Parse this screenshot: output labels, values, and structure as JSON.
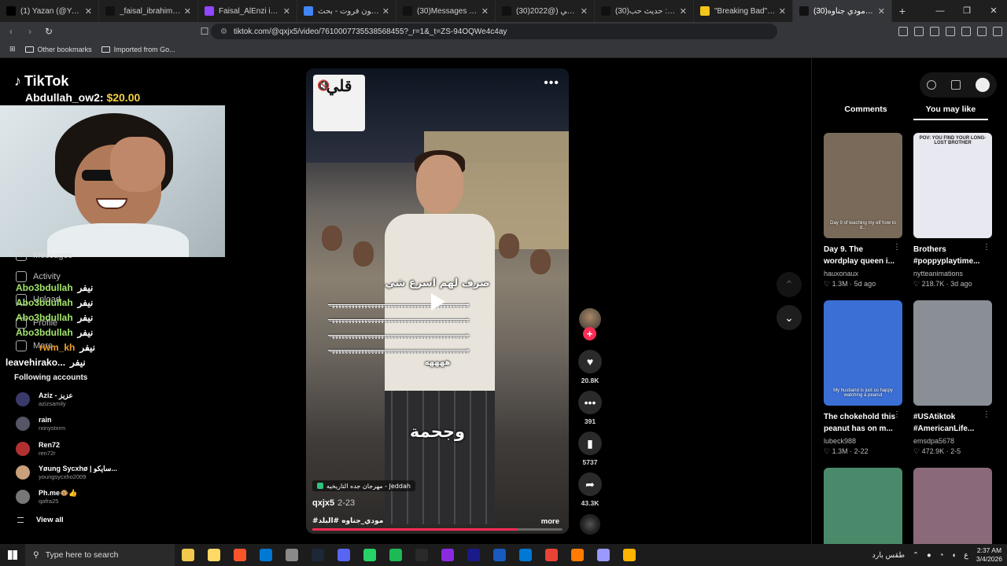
{
  "browser": {
    "tabs": [
      {
        "label": "(1) Yazan (@YazanWasHiro",
        "color": "#000000"
      },
      {
        "label": "_faisal_ibrahim_f) | TikTok",
        "color": "#111111"
      },
      {
        "label": "Faisal_AlEnzi in JACO - JAC",
        "color": "#9146ff"
      },
      {
        "label": "دراغون فروت - بحث Google",
        "color": "#4285f4"
      },
      {
        "label": "(30)Messages | TikTok",
        "color": "#111111"
      },
      {
        "label": "(30)حسين البارقي (@2022",
        "color": "#111111"
      },
      {
        "label": "(30)حسين البارقي: حديث حب",
        "color": "#111111"
      },
      {
        "label": "\"Breaking Bad\" Ozymandi",
        "color": "#f5c518"
      },
      {
        "label": "(30)أغاني مودي جناوه",
        "color": "#111111",
        "active": true
      }
    ],
    "new_tab": "+",
    "url": "tiktok.com/@qxjx5/video/7610007735538568455?_r=1&_t=ZS-94OQWe4c4ay",
    "bookmarks": [
      "Other bookmarks",
      "Imported from Go..."
    ]
  },
  "left": {
    "logo_text": "TikTok",
    "donation_user": "Abdullah_ow2:",
    "donation_amount": "$20.00",
    "chat": [
      {
        "nick": "Abo3bdullah",
        "msg": "نيفر",
        "cls": ""
      },
      {
        "nick": "Abo3bdullah",
        "msg": "نيفر",
        "cls": ""
      },
      {
        "nick": "Abo3bdullah",
        "msg": "نيفر",
        "cls": ""
      },
      {
        "nick": "Abo3bdullah",
        "msg": "نيفر",
        "cls": ""
      },
      {
        "nick": "rwm_kh",
        "msg": "نيفر",
        "cls": "orange"
      },
      {
        "nick": "leavehirako...",
        "msg": "نيفر",
        "cls": "white"
      }
    ],
    "ghost_nav": [
      "Messages",
      "Activity",
      "Upload",
      "Profile",
      "More"
    ],
    "following_title": "Following accounts",
    "accounts": [
      {
        "name": "Aziz - عزيز",
        "handle": "azizsamily",
        "color": "#3a3a6a"
      },
      {
        "name": "rain",
        "handle": "rxinystxrm",
        "color": "#555566"
      },
      {
        "name": "Ren72",
        "handle": "ren72r",
        "color": "#b33030"
      },
      {
        "name": "Yøung Sycxhø | سايكو...",
        "handle": "youngsycxho2009",
        "color": "#c9a07a"
      },
      {
        "name": "Ph.me🐵👍",
        "handle": "qafra25",
        "color": "#777777"
      }
    ],
    "view_all": "View all"
  },
  "video": {
    "logo_text": "قلي",
    "mute_icon": "🔇",
    "more_icon": "•••",
    "caption_top": "صرف لهم اسرع شي",
    "strike_char": "ههههههههههههههههههههههههههههههههههههههههههه",
    "laugh_tail": "ههههه",
    "caption_bottom": "وجحمة",
    "location": "مهرجان جده التاريخيه - Jeddah",
    "author": "qxjx5",
    "date": "2-23",
    "hashtags": "#مودي_جناوه #البلد",
    "more_label": "more",
    "progress_percent": 82
  },
  "actions": {
    "follow": "+",
    "likes": "20.8K",
    "comments": "391",
    "saves": "5737",
    "shares": "43.3K"
  },
  "right": {
    "tabs": [
      "Comments",
      "You may like"
    ],
    "cards": [
      {
        "title": "Day 9. The wordplay queen i...",
        "author": "hauxonaux",
        "views": "1.3M",
        "age": "5d ago",
        "bg": "#7a6a5a",
        "overlay": "Day 9 of teaching my elf how to d..."
      },
      {
        "title": "Brothers #poppyplaytime...",
        "author": "nytteanimations",
        "views": "218.7K",
        "age": "3d ago",
        "bg": "#e8e8f0",
        "overlay": "POV: YOU FIND YOUR LONG-LOST BROTHER"
      },
      {
        "title": "The chokehold this peanut has on m...",
        "author": "lubeck988",
        "views": "1.3M",
        "age": "2-22",
        "bg": "#3b6fd6",
        "overlay": "My husband is just so happy watching a peanut"
      },
      {
        "title": "#USAtiktok #AmericanLife...",
        "author": "emsdpa5678",
        "views": "472.9K",
        "age": "2-5",
        "bg": "#8a8f96",
        "overlay": ""
      },
      {
        "title": "",
        "author": "",
        "views": "",
        "age": "",
        "bg": "#4a8a6a",
        "overlay": ""
      },
      {
        "title": "",
        "author": "",
        "views": "",
        "age": "",
        "bg": "#8a6a7a",
        "overlay": ""
      }
    ]
  },
  "taskbar": {
    "search_placeholder": "Type here to search",
    "weather": "طقس بارد",
    "time": "2:37 AM",
    "date": "3/4/2026",
    "lang": "ع",
    "apps": [
      "#f2c94c",
      "#ffd966",
      "#fb542b",
      "#0078d4",
      "#8a8a8a",
      "#1b2838",
      "#5865f2",
      "#25d366",
      "#1db954",
      "#2a2a2a",
      "#8a2be2",
      "#1a1a8a",
      "#185abd",
      "#0078d4",
      "#ea4335",
      "#ff7c00",
      "#9999ff",
      "#ffb400"
    ]
  }
}
